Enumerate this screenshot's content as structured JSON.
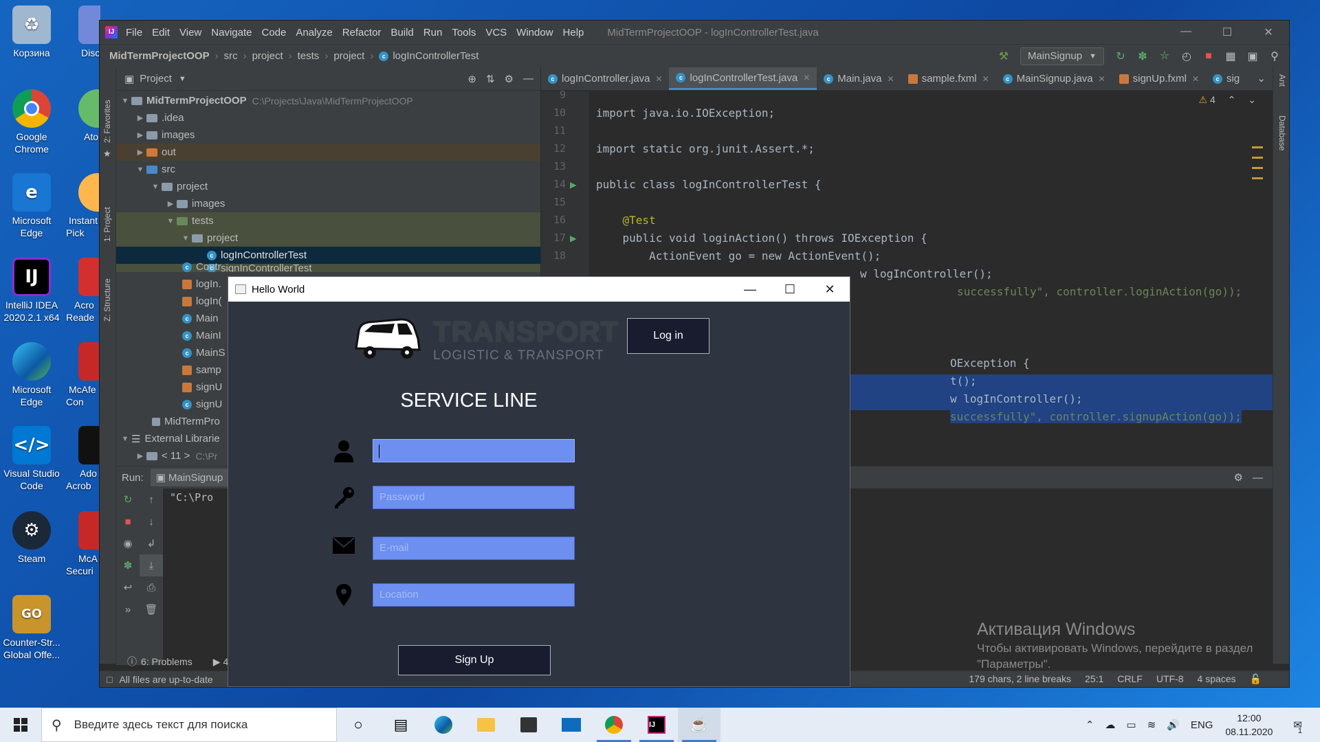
{
  "desktop": {
    "icons": [
      {
        "label": "Корзина"
      },
      {
        "label": "Google Chrome"
      },
      {
        "label": "Microsoft Edge"
      },
      {
        "label": "IntelliJ IDEA 2020.2.1 x64"
      },
      {
        "label": "Microsoft Edge"
      },
      {
        "label": "Visual Studio Code"
      },
      {
        "label": "Steam"
      },
      {
        "label": "Counter-Str... Global Offe..."
      },
      {
        "label": "Disc"
      },
      {
        "label": "Ato"
      },
      {
        "label": "Instant Pick"
      },
      {
        "label": "Acro Reade"
      },
      {
        "label": "McAfe Con"
      },
      {
        "label": "Ado Acrob"
      },
      {
        "label": "McA Securi"
      }
    ]
  },
  "ide": {
    "menu": [
      "File",
      "Edit",
      "View",
      "Navigate",
      "Code",
      "Analyze",
      "Refactor",
      "Build",
      "Run",
      "Tools",
      "VCS",
      "Window",
      "Help"
    ],
    "window_title": "MidTermProjectOOP - logInControllerTest.java",
    "breadcrumbs": [
      "MidTermProjectOOP",
      "src",
      "project",
      "tests",
      "project",
      "logInControllerTest"
    ],
    "run_config": "MainSignup",
    "left_stripe": [
      "2: Favorites",
      "1: Project",
      "Z: Structure"
    ],
    "right_stripe": [
      "Ant",
      "Database"
    ],
    "project_panel_title": "Project",
    "tree": [
      {
        "label": "MidTermProjectOOP",
        "path": "C:\\Projects\\Java\\MidTermProjectOOP"
      },
      {
        "label": ".idea"
      },
      {
        "label": "images"
      },
      {
        "label": "out"
      },
      {
        "label": "src"
      },
      {
        "label": "project"
      },
      {
        "label": "images"
      },
      {
        "label": "tests"
      },
      {
        "label": "project"
      },
      {
        "label": "logInControllerTest"
      },
      {
        "label": "signInControllerTest"
      },
      {
        "label": "Contr"
      },
      {
        "label": "logIn."
      },
      {
        "label": "logIn("
      },
      {
        "label": "Main"
      },
      {
        "label": "MainI"
      },
      {
        "label": "MainS"
      },
      {
        "label": "samp"
      },
      {
        "label": "signU"
      },
      {
        "label": "signU"
      },
      {
        "label": "MidTermPro"
      },
      {
        "label": "External Librarie"
      },
      {
        "label": "< 11 >",
        "path": "C:\\Pr"
      }
    ],
    "tabs": [
      "logInController.java",
      "logInControllerTest.java",
      "Main.java",
      "sample.fxml",
      "MainSignup.java",
      "signUp.fxml",
      "sig"
    ],
    "warnings": "4",
    "code_lines": [
      {
        "n": "9",
        "text": ""
      },
      {
        "n": "10",
        "text": "import java.io.IOException;"
      },
      {
        "n": "11",
        "text": ""
      },
      {
        "n": "12",
        "text": "import static org.junit.Assert.*;"
      },
      {
        "n": "13",
        "text": ""
      },
      {
        "n": "14",
        "text": "public class logInControllerTest {"
      },
      {
        "n": "15",
        "text": ""
      },
      {
        "n": "16",
        "text": "    @Test"
      },
      {
        "n": "17",
        "text": "    public void loginAction() throws IOException {"
      },
      {
        "n": "18",
        "text": "        ActionEvent go = new ActionEvent();"
      },
      {
        "n": "",
        "text": "w logInController();"
      },
      {
        "n": "",
        "text": "successfully\", controller.loginAction(go));"
      },
      {
        "n": "",
        "text": "OException {"
      },
      {
        "n": "",
        "text": "t();"
      },
      {
        "n": "",
        "text": "w logInController();"
      },
      {
        "n": "",
        "text": "successfully\", controller.signupAction(go));"
      }
    ],
    "run": {
      "label": "Run:",
      "tab": "MainSignup",
      "console": "\"C:\\Pro"
    },
    "bottom_tabs": {
      "problems": "6: Problems",
      "run_number": "4"
    },
    "status": {
      "left": "All files are up-to-date",
      "chars": "179 chars, 2 line breaks",
      "pos": "25:1",
      "line_sep": "CRLF",
      "encoding": "UTF-8",
      "indent": "4 spaces"
    },
    "watermark": {
      "title": "Активация Windows",
      "line1": "Чтобы активировать Windows, перейдите в раздел",
      "line2": "\"Параметры\"."
    }
  },
  "app": {
    "title": "Hello World",
    "logo_big": "TRANSPORT",
    "logo_small": "LOGISTIC & TRANSPORT",
    "login_label": "Log in",
    "heading": "SERVICE LINE",
    "fields": {
      "username": {
        "value": "",
        "placeholder": ""
      },
      "password": {
        "placeholder": "Password"
      },
      "email": {
        "placeholder": "E-mail"
      },
      "location": {
        "placeholder": "Location"
      }
    },
    "signup_label": "Sign Up"
  },
  "taskbar": {
    "search_placeholder": "Введите здесь текст для поиска",
    "lang": "ENG",
    "time": "12:00",
    "date": "08.11.2020",
    "notifications": "1"
  }
}
